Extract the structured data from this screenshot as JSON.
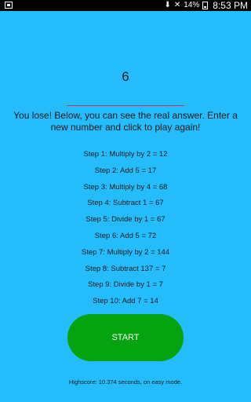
{
  "status_bar": {
    "battery_percent": "14%",
    "time": "8:53 PM",
    "icons": [
      "notification-icon",
      "download-icon",
      "mute-icon",
      "wifi-icon",
      "battery-icon"
    ]
  },
  "game": {
    "current_number": "6",
    "input_value": "",
    "message": "You lose! Below, you can see the real answer. Enter a new number and click to play again!",
    "steps": [
      "Step 1: Multiply by 2 = 12",
      "Step 2: Add 5 = 17",
      "Step 3: Multiply by 4 = 68",
      "Step 4: Subtract 1 = 67",
      "Step 5: Divide by 1 = 67",
      "Step 6: Add 5 = 72",
      "Step 7: Multiply by 2 = 144",
      "Step 8: Subtract 137 = 7",
      "Step 9: Divide by 1 = 7",
      "Step 10: Add 7 = 14"
    ],
    "start_label": "START",
    "highscore": "Highscore: 10.374 seconds, on easy mode."
  },
  "colors": {
    "background": "#24bcfa",
    "button": "#05a30f",
    "input_underline": "#d0306a"
  }
}
